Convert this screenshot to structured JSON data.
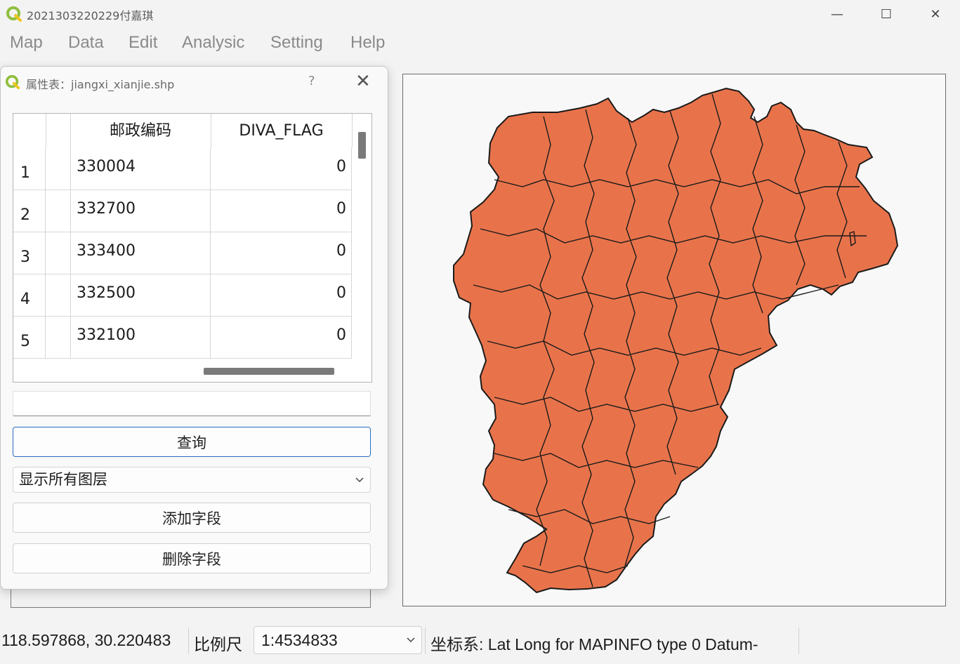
{
  "window": {
    "title": "2021303220229付嘉琪",
    "minimize_glyph": "—",
    "maximize_glyph": "☐",
    "close_glyph": "✕"
  },
  "menu": [
    "Map",
    "Data",
    "Edit",
    "Analysic",
    "Setting",
    "Help"
  ],
  "dialog": {
    "title": "属性表：jiangxi_xianjie.shp",
    "help_glyph": "?",
    "close_glyph": "✕",
    "table": {
      "columns": [
        "邮政编码",
        "DIVA_FLAG"
      ],
      "rows": [
        {
          "num": "1",
          "code": "330004",
          "flag": "0"
        },
        {
          "num": "2",
          "code": "332700",
          "flag": "0"
        },
        {
          "num": "3",
          "code": "333400",
          "flag": "0"
        },
        {
          "num": "4",
          "code": "332500",
          "flag": "0"
        },
        {
          "num": "5",
          "code": "332100",
          "flag": "0"
        }
      ]
    },
    "query_input_value": "",
    "query_button": "查询",
    "layer_select": "显示所有图层",
    "add_field_button": "添加字段",
    "delete_field_button": "删除字段"
  },
  "map": {
    "fill_color": "#e8734b",
    "stroke_color": "#1a1a1a",
    "background": "#f8f8f8"
  },
  "status": {
    "coordinates": "118.597868, 30.220483",
    "scale_label": "比例尺",
    "scale_value": "1:4534833",
    "crs": "坐标系: Lat Long for MAPINFO type 0 Datum-"
  },
  "icons": {
    "app": "qgis-logo-icon",
    "chevron": "chevron-down-icon"
  }
}
